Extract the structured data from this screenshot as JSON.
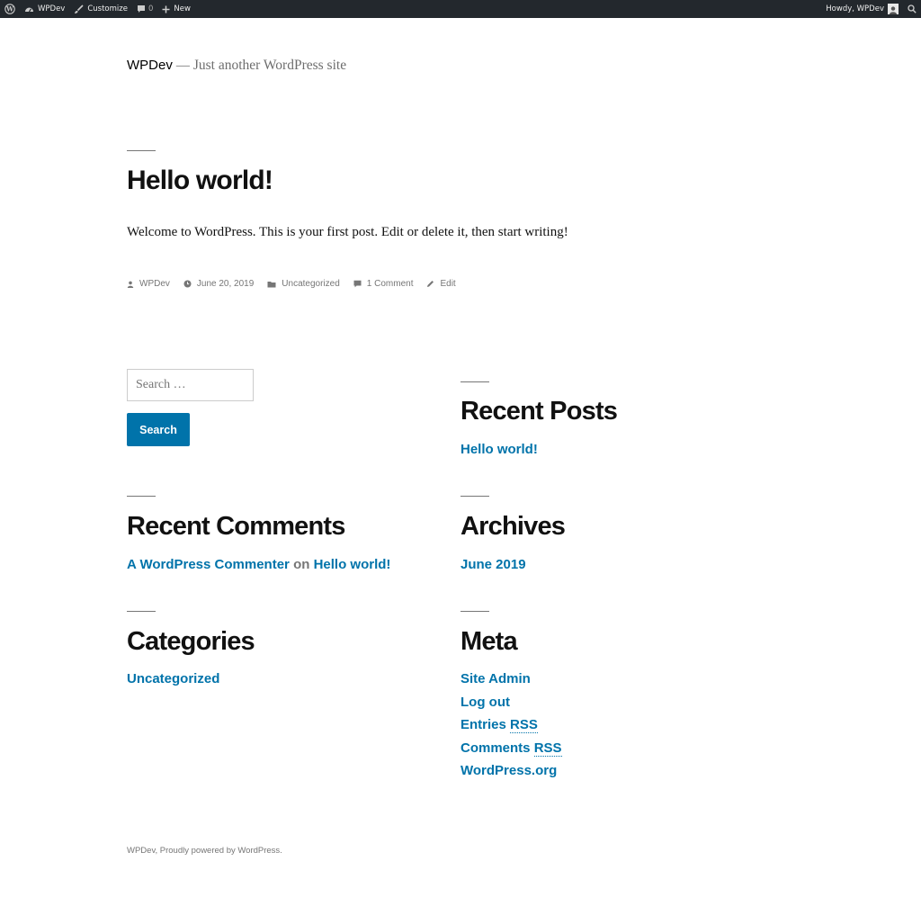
{
  "admin_bar": {
    "site_label": "WPDev",
    "customize_label": "Customize",
    "comments_count": "0",
    "new_label": "New",
    "greeting": "Howdy, WPDev"
  },
  "site": {
    "title": "WPDev",
    "separator": "—",
    "description": "Just another WordPress site"
  },
  "post": {
    "title": "Hello world!",
    "body": "Welcome to WordPress. This is your first post. Edit or delete it, then start writing!",
    "meta": {
      "author": "WPDev",
      "date": "June 20, 2019",
      "category": "Uncategorized",
      "comments": "1 Comment",
      "edit": "Edit"
    }
  },
  "widgets": {
    "search": {
      "placeholder": "Search …",
      "button_label": "Search"
    },
    "recent_posts": {
      "title": "Recent Posts",
      "items": [
        "Hello world!"
      ]
    },
    "recent_comments": {
      "title": "Recent Comments",
      "author": "A WordPress Commenter",
      "on": "on",
      "post": "Hello world!"
    },
    "archives": {
      "title": "Archives",
      "items": [
        "June 2019"
      ]
    },
    "categories": {
      "title": "Categories",
      "items": [
        "Uncategorized"
      ]
    },
    "meta": {
      "title": "Meta",
      "site_admin": "Site Admin",
      "log_out": "Log out",
      "entries_prefix": "Entries ",
      "comments_prefix": "Comments ",
      "rss": "RSS",
      "wordpress_org": "WordPress.org"
    }
  },
  "footer": {
    "text": "WPDev, Proudly powered by WordPress."
  },
  "colors": {
    "link": "#0073aa",
    "admin_bar": "#23282d",
    "text": "#111111",
    "muted": "#767676"
  }
}
